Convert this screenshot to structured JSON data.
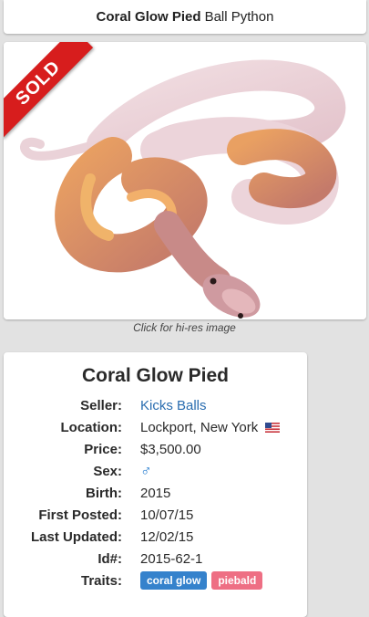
{
  "header": {
    "title_bold": "Coral Glow Pied",
    "title_rest": "Ball Python"
  },
  "image": {
    "sold_label": "SOLD",
    "caption": "Click for hi-res image"
  },
  "details": {
    "title": "Coral Glow Pied",
    "rows": {
      "seller": {
        "label": "Seller:",
        "value": "Kicks Balls"
      },
      "location": {
        "label": "Location:",
        "value": "Lockport, New York",
        "flag_icon": "us-flag-icon"
      },
      "price": {
        "label": "Price:",
        "value": "$3,500.00"
      },
      "sex": {
        "label": "Sex:",
        "value": "♂",
        "icon": "male-symbol-icon"
      },
      "birth": {
        "label": "Birth:",
        "value": "2015"
      },
      "first_posted": {
        "label": "First Posted:",
        "value": "10/07/15"
      },
      "last_updated": {
        "label": "Last Updated:",
        "value": "12/02/15"
      },
      "id": {
        "label": "Id#:",
        "value": "2015-62-1"
      },
      "traits": {
        "label": "Traits:",
        "items": [
          "coral glow",
          "piebald"
        ]
      }
    }
  },
  "colors": {
    "sold_ribbon": "#d71d1d",
    "link": "#2a6db0",
    "trait_coral_glow": "#3582cc",
    "trait_piebald": "#ee6f84"
  }
}
